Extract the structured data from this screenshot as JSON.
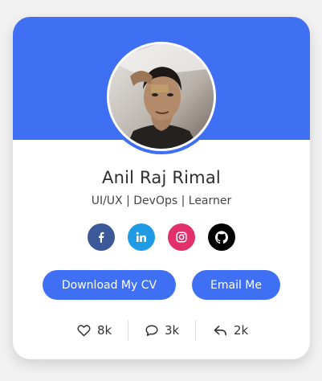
{
  "profile": {
    "name": "Anil Raj Rimal",
    "tagline": "UI/UX | DevOps | Learner"
  },
  "socials": [
    {
      "name": "facebook",
      "icon": "facebook-icon",
      "color": "#3b5998"
    },
    {
      "name": "linkedin",
      "icon": "linkedin-icon",
      "color": "#1f9be6"
    },
    {
      "name": "instagram",
      "icon": "instagram-icon",
      "color": "#e1306c"
    },
    {
      "name": "github",
      "icon": "github-icon",
      "color": "#000000"
    }
  ],
  "buttons": {
    "cv_label": "Download My CV",
    "email_label": "Email Me"
  },
  "stats": {
    "likes": "8k",
    "comments": "3k",
    "shares": "2k"
  },
  "colors": {
    "accent": "#3f6ff3",
    "card": "#ffffff",
    "background": "#f2f2f2"
  }
}
